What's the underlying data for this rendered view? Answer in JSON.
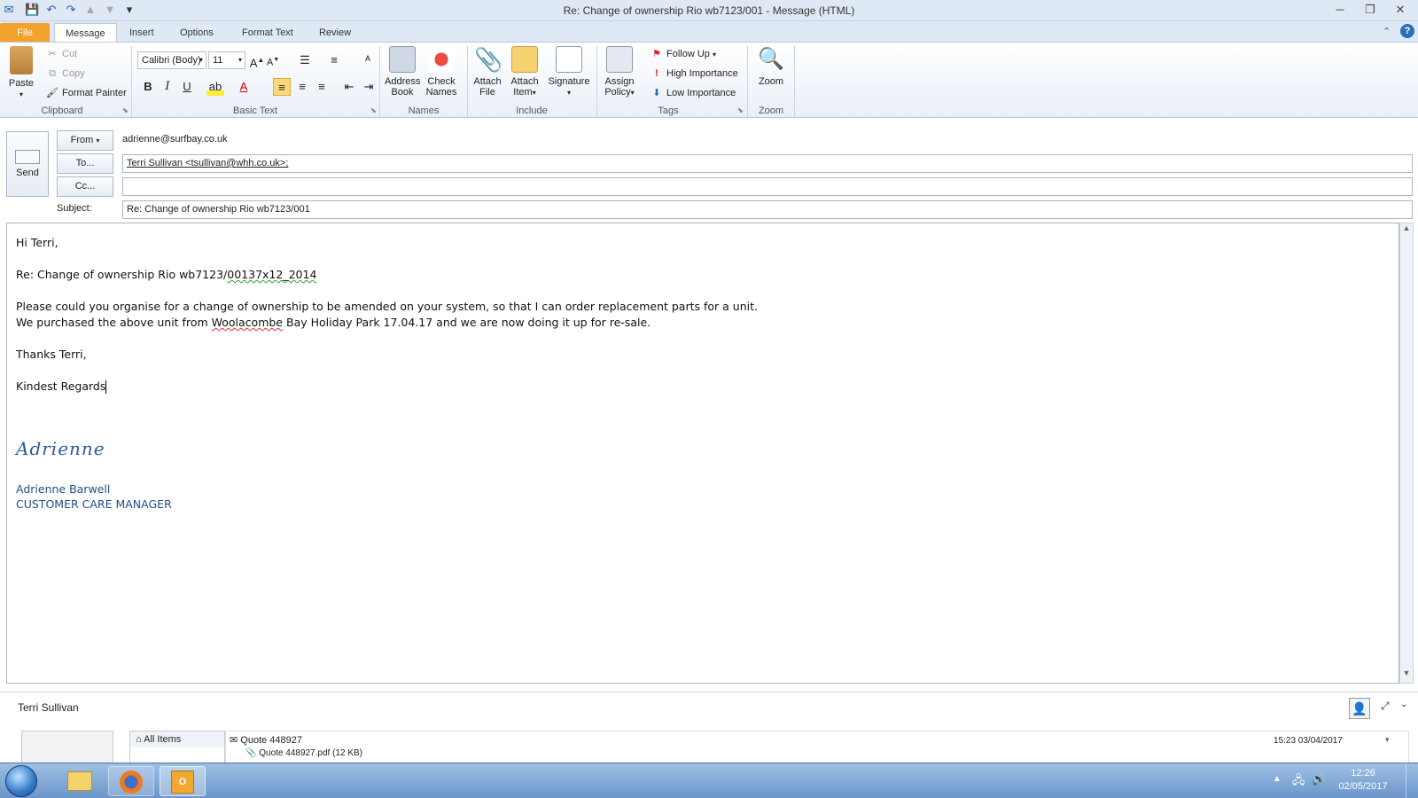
{
  "window": {
    "title": "Re: Change of ownership Rio wb7123/001  -  Message (HTML)",
    "controls": [
      "minimize-icon",
      "restore-icon",
      "close-icon"
    ]
  },
  "tabs": [
    "File",
    "Message",
    "Insert",
    "Options",
    "Format Text",
    "Review"
  ],
  "active_tab": "Message",
  "ribbon": {
    "clipboard": {
      "label": "Clipboard",
      "paste": "Paste",
      "cut": "Cut",
      "copy": "Copy",
      "format_painter": "Format Painter"
    },
    "basic_text": {
      "label": "Basic Text",
      "font": "Calibri (Body)",
      "size": "11"
    },
    "names": {
      "label": "Names",
      "address_book": "Address Book",
      "check_names": "Check Names"
    },
    "include": {
      "label": "Include",
      "attach_file": "Attach File",
      "attach_item": "Attach Item",
      "signature": "Signature"
    },
    "tags": {
      "label": "Tags",
      "assign_policy": "Assign Policy",
      "follow_up": "Follow Up",
      "high_importance": "High Importance",
      "low_importance": "Low Importance"
    },
    "zoom": {
      "label": "Zoom",
      "zoom": "Zoom"
    }
  },
  "header": {
    "send": "Send",
    "from_label": "From",
    "from_value": "adrienne@surfbay.co.uk",
    "to_label": "To...",
    "to_value": "Terri Sullivan <tsullivan@whh.co.uk>;",
    "cc_label": "Cc...",
    "cc_value": "",
    "subject_label": "Subject:",
    "subject_value": "Re: Change of ownership Rio wb7123/001"
  },
  "body": {
    "greeting": "Hi Terri,",
    "reline_a": "Re: Change of ownership Rio wb7123/",
    "reline_b": "00137x12_2014",
    "para1": "Please could you organise for a change of ownership to be amended on your system, so that I can order replacement parts for a unit.",
    "para2_a": "We purchased the above unit from ",
    "para2_b": "Woolacombe",
    "para2_c": " Bay Holiday Park 17.04.17 and we are now doing it up for re-sale.",
    "thanks": "Thanks Terri,",
    "regards": "Kindest Regards",
    "signature_script": "Adrienne",
    "sig_name": "Adrienne Barwell",
    "sig_title": "CUSTOMER CARE MANAGER"
  },
  "people_pane": {
    "contact": "Terri Sullivan",
    "all_items": "All Items",
    "item_title": "Quote 448927",
    "item_attachment": "Quote 448927.pdf (12 KB)",
    "item_date": "15:23  03/04/2017"
  },
  "taskbar": {
    "time": "12:26",
    "date": "02/05/2017"
  },
  "colors": {
    "file_tab": "#f3a32d",
    "signature_blue": "#1f4e8c",
    "taskbar": "#6b95c9"
  }
}
